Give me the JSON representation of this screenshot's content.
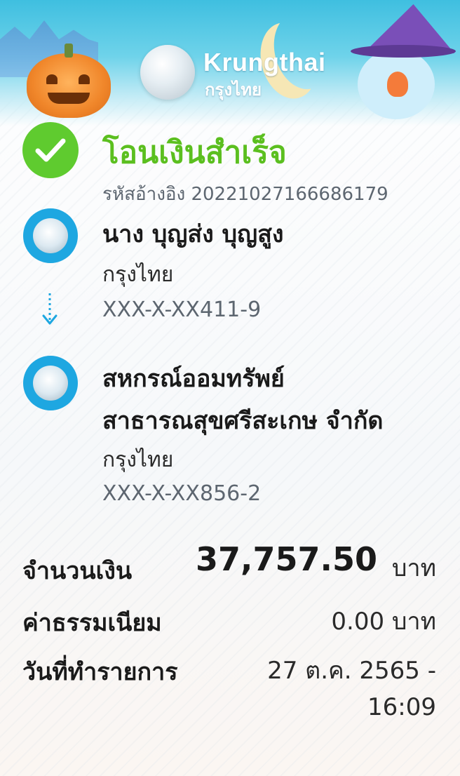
{
  "header": {
    "brand_name": "Krungthai",
    "brand_name_thai": "กรุงไทย"
  },
  "status": {
    "title": "โอนเงินสำเร็จ",
    "reference": "รหัสอ้างอิง 20221027166686179",
    "color": "#5bbf1f"
  },
  "sender": {
    "name": "นาง บุญส่ง บุญสูง",
    "bank": "กรุงไทย",
    "account": "XXX-X-XX411-9"
  },
  "recipient": {
    "name_line1": "สหกรณ์ออมทรัพย์",
    "name_line2": "สาธารณสุขศรีสะเกษ จำกัด",
    "bank": "กรุงไทย",
    "account": "XXX-X-XX856-2"
  },
  "details": {
    "amount_label": "จำนวนเงิน",
    "amount_value": "37,757.50",
    "amount_unit": "บาท",
    "fee_label": "ค่าธรรมเนียม",
    "fee_value": "0.00 บาท",
    "date_label": "วันที่ทำรายการ",
    "date_value": "27 ต.ค. 2565 -",
    "time_value": "16:09"
  },
  "icons": {
    "success": "check-icon",
    "bank": "krungthai-logo-icon",
    "direction": "arrow-down-icon"
  },
  "colors": {
    "brand_blue": "#1ea7e1",
    "success_green": "#5fcb2f"
  }
}
